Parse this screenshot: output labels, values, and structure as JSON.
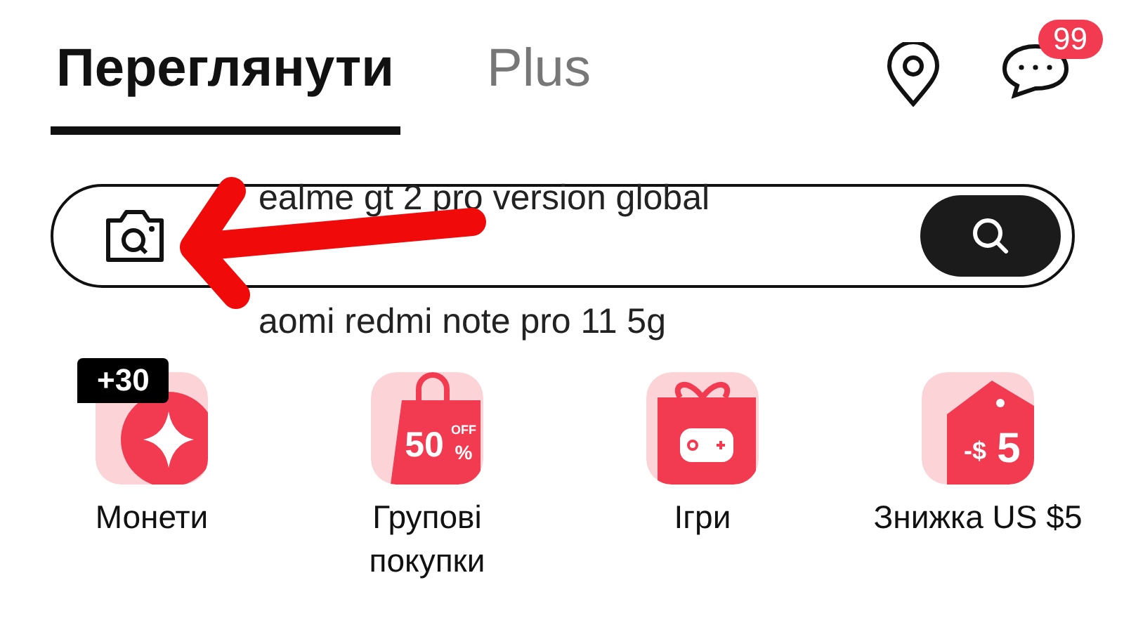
{
  "header": {
    "tabs": [
      {
        "label": "Переглянути",
        "selected": true
      },
      {
        "label": "Plus",
        "selected": false
      }
    ],
    "messages_badge": "99"
  },
  "search": {
    "hints": [
      "ealme gt 2 pro version global",
      "aomi redmi note pro 11 5g"
    ]
  },
  "tiles": [
    {
      "label": "Монети",
      "kind": "coins",
      "badge": "+30"
    },
    {
      "label": "Групові покупки",
      "kind": "group-buy",
      "icon_texts": [
        "50",
        "OFF",
        "%"
      ]
    },
    {
      "label": "Ігри",
      "kind": "games"
    },
    {
      "label": "Знижка US $5",
      "kind": "discount",
      "icon_texts": [
        "-$",
        "5"
      ]
    }
  ]
}
